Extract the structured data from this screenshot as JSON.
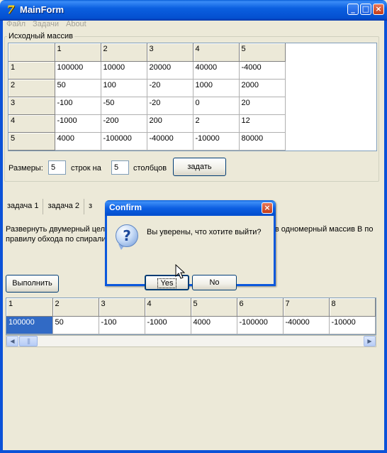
{
  "window": {
    "title": "MainForm",
    "icon": "delphi-app-icon",
    "controls": {
      "minimize": "_",
      "maximize": "□",
      "close": "×"
    }
  },
  "menu": [
    "Файл",
    "Задачи",
    "About"
  ],
  "source_group": {
    "label": "Исходный массив",
    "header": [
      "",
      "1",
      "2",
      "3",
      "4",
      "5"
    ],
    "rows": [
      [
        "1",
        "100000",
        "10000",
        "20000",
        "40000",
        "-4000"
      ],
      [
        "2",
        "50",
        "100",
        "-20",
        "1000",
        "2000"
      ],
      [
        "3",
        "-100",
        "-50",
        "-20",
        "0",
        "20"
      ],
      [
        "4",
        "-1000",
        "-200",
        "200",
        "2",
        "12"
      ],
      [
        "5",
        "4000",
        "-100000",
        "-40000",
        "-10000",
        "80000"
      ]
    ]
  },
  "size_controls": {
    "label_sizes": "Размеры:",
    "rows_value": "5",
    "label_rows": "строк на",
    "cols_value": "5",
    "label_cols": "столбцов",
    "set_button": "задать"
  },
  "tabs": [
    "задача 1",
    "задача 2",
    "з"
  ],
  "task_description_line1_left": "Развернуть двумерный цел",
  "task_description_line1_right": "в в одномерный массив B по",
  "task_description_line2": "правилу обхода по спирали",
  "run_button": "Выполнить",
  "result_grid": {
    "header": [
      "1",
      "2",
      "3",
      "4",
      "5",
      "6",
      "7",
      "8"
    ],
    "values": [
      "100000",
      "50",
      "-100",
      "-1000",
      "4000",
      "-100000",
      "-40000",
      "-10000"
    ],
    "selected_index": 0
  },
  "dialog": {
    "title": "Confirm",
    "message": "Вы уверены, что хотите выйти?",
    "yes": "Yes",
    "no": "No",
    "icon": "question-icon"
  },
  "colors": {
    "titlebar": "#0b5fe0",
    "window_bg": "#ece9d8",
    "selection": "#316ac5",
    "close_button": "#c33d18"
  }
}
